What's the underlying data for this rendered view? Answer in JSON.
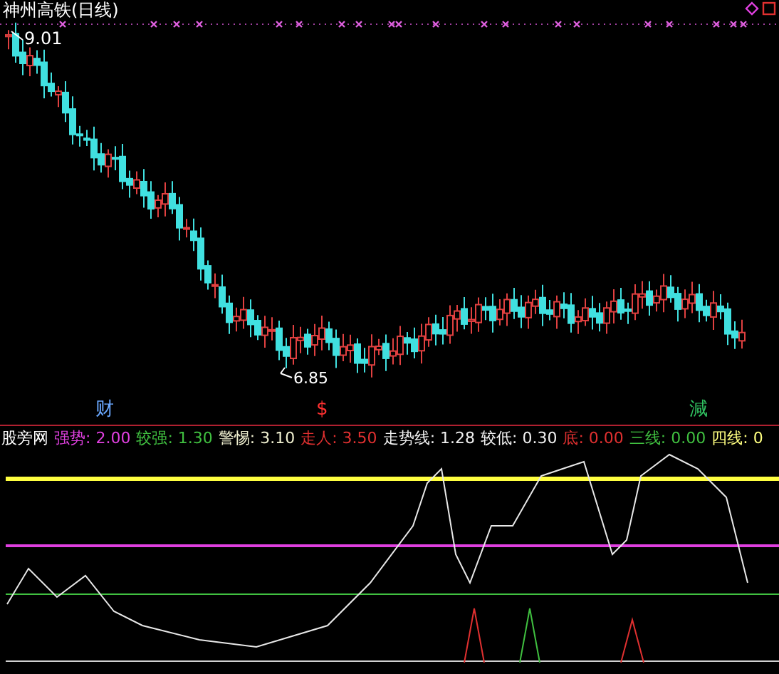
{
  "chart_title": "神州高铁(日线)",
  "high_label": "9.01",
  "low_label": "6.85",
  "signals": [
    {
      "text": "财",
      "color": "#6aa8ff"
    },
    {
      "text": "$",
      "color": "#ff3030"
    },
    {
      "text": "減",
      "color": "#30c060"
    }
  ],
  "legend": {
    "name": "股旁网",
    "items": [
      {
        "label": "强势: 2.00",
        "color": "#e040e0"
      },
      {
        "label": "较强: 1.30",
        "color": "#40c040"
      },
      {
        "label": "警惕: 3.10",
        "color": "#f0f0d0"
      },
      {
        "label": "走人: 3.50",
        "color": "#e03030"
      },
      {
        "label": "走势线: 1.28",
        "color": "#f0f0f0"
      },
      {
        "label": "较低: 0.30",
        "color": "#f0f0f0"
      },
      {
        "label": "底: 0.00",
        "color": "#e03030"
      },
      {
        "label": "三线: 0.00",
        "color": "#40c040"
      },
      {
        "label": "四线: 0",
        "color": "#ffff80"
      }
    ]
  }
}
